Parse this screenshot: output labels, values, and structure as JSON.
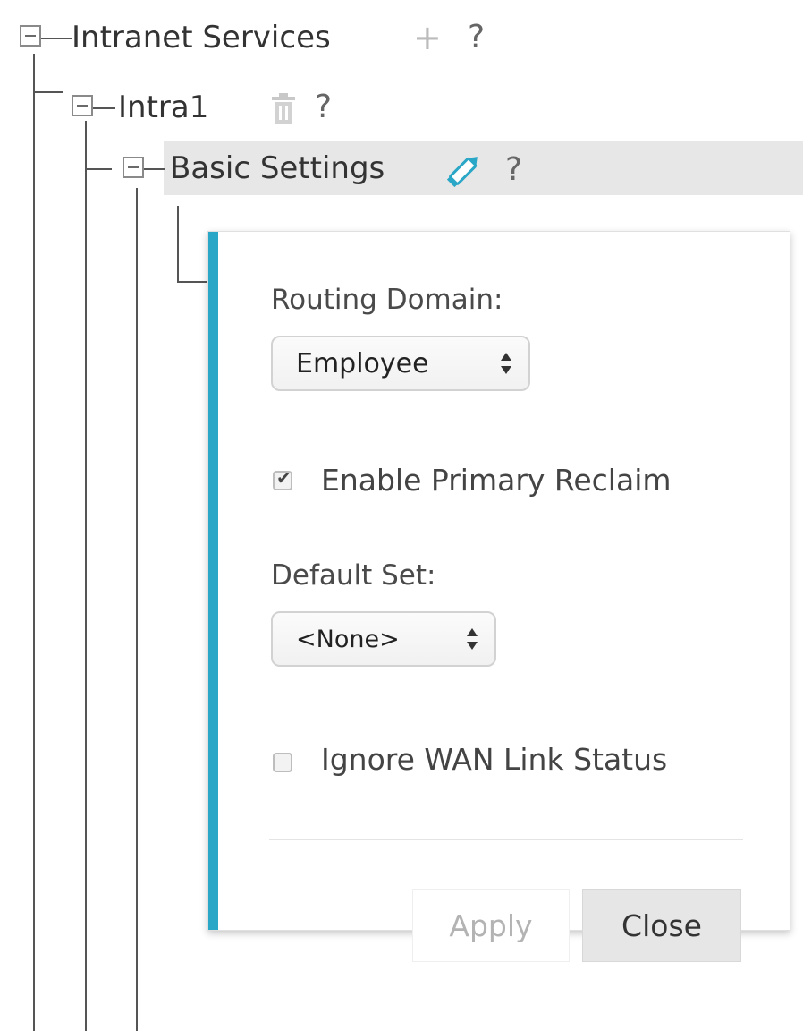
{
  "tree": {
    "root": {
      "label": "Intranet Services",
      "add_icon": "+",
      "help_icon": "?"
    },
    "child": {
      "label": "Intra1",
      "help_icon": "?"
    },
    "grandchild": {
      "label": "Basic Settings",
      "help_icon": "?"
    }
  },
  "panel": {
    "accent_color": "#2aa7c6",
    "routing_domain": {
      "label": "Routing Domain:",
      "value": "Employee"
    },
    "enable_primary_reclaim": {
      "label": "Enable Primary Reclaim",
      "checked": true
    },
    "default_set": {
      "label": "Default Set:",
      "value": "<None>"
    },
    "ignore_wan_link_status": {
      "label": "Ignore WAN Link Status",
      "checked": false
    },
    "apply_label": "Apply",
    "close_label": "Close"
  }
}
